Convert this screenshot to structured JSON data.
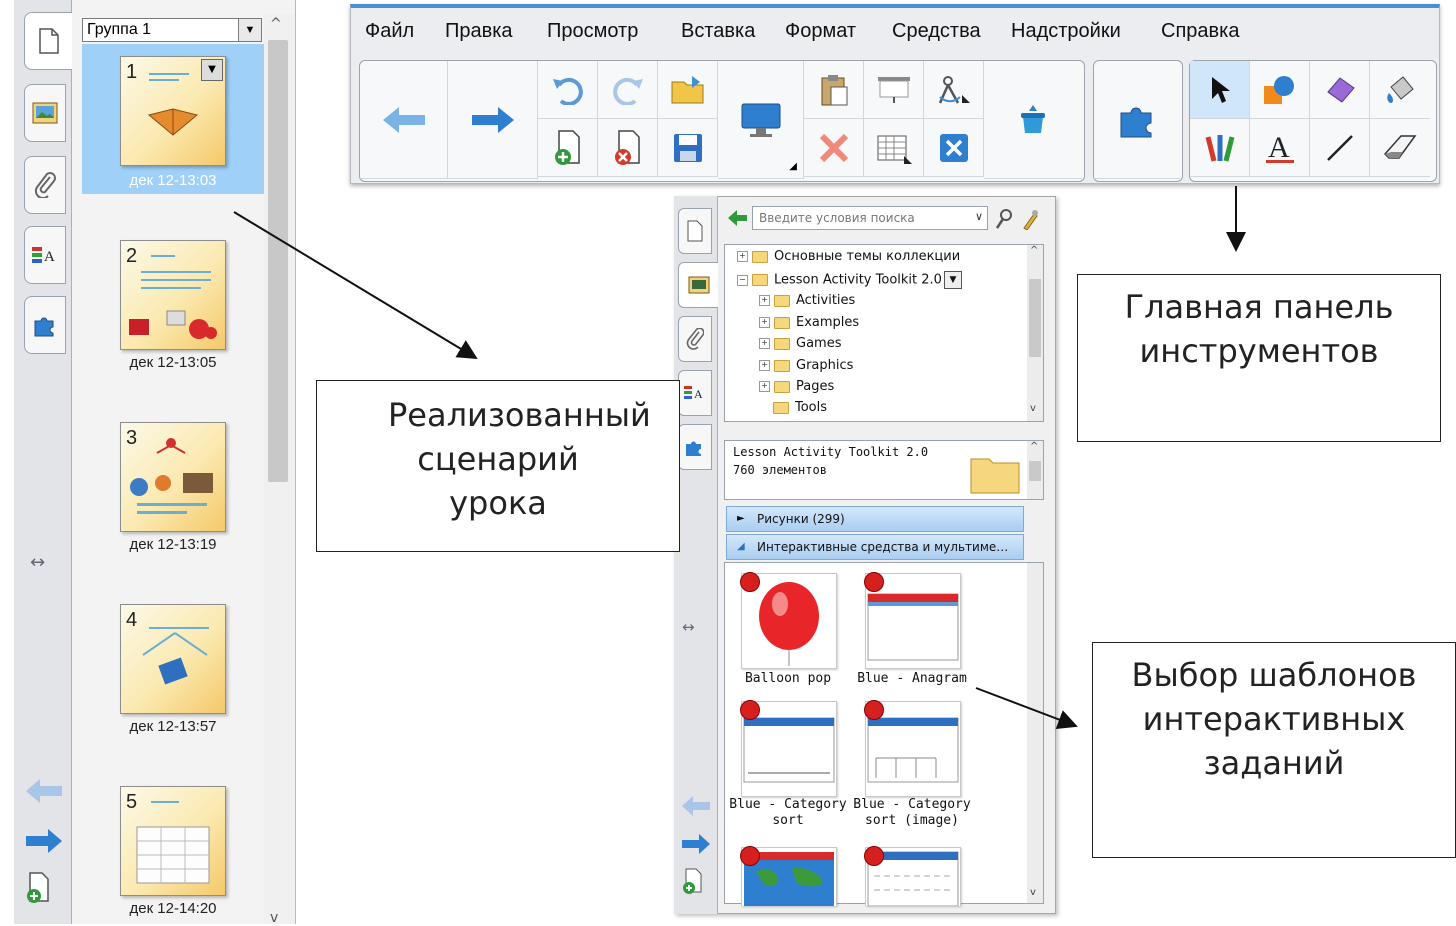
{
  "left_panel": {
    "group_label": "Группа 1",
    "slides": [
      {
        "number": "1",
        "time": "дек 12-13:03",
        "selected": true
      },
      {
        "number": "2",
        "time": "дек 12-13:05",
        "selected": false
      },
      {
        "number": "3",
        "time": "дек 12-13:19",
        "selected": false
      },
      {
        "number": "4",
        "time": "дек 12-13:57",
        "selected": false
      },
      {
        "number": "5",
        "time": "дек 12-14:20",
        "selected": false
      }
    ]
  },
  "toolbar": {
    "menu": [
      "Файл",
      "Правка",
      "Просмотр",
      "Вставка",
      "Формат",
      "Средства",
      "Надстройки",
      "Справка"
    ]
  },
  "gallery": {
    "search_placeholder": "Введите условия поиска",
    "tree": [
      {
        "label": "Основные темы коллекции",
        "level": 0,
        "expander": "+"
      },
      {
        "label": "Lesson Activity Toolkit 2.0",
        "level": 0,
        "expander": "−"
      },
      {
        "label": "Activities",
        "level": 1,
        "expander": "+"
      },
      {
        "label": "Examples",
        "level": 1,
        "expander": "+"
      },
      {
        "label": "Games",
        "level": 1,
        "expander": "+"
      },
      {
        "label": "Graphics",
        "level": 1,
        "expander": "+"
      },
      {
        "label": "Pages",
        "level": 1,
        "expander": "+"
      },
      {
        "label": "Tools",
        "level": 1,
        "expander": ""
      }
    ],
    "info_title": "Lesson Activity Toolkit 2.0",
    "info_count": "760 элементов",
    "categories": [
      {
        "label": "Рисунки (299)",
        "arrow": "►"
      },
      {
        "label": "Интерактивные средства и мультиме…",
        "arrow": "◢"
      }
    ],
    "items": [
      {
        "label": "Balloon pop"
      },
      {
        "label": "Blue - Anagram"
      },
      {
        "label": "Blue - Category sort"
      },
      {
        "label": "Blue - Category sort (image)"
      }
    ]
  },
  "callouts": {
    "lesson": "Реализованный сценарий урока",
    "toolbar": "Главная панель инструментов",
    "templates": "Выбор шаблонов интерактивных заданий"
  },
  "colors": {
    "accent_blue": "#3d8fd8",
    "selection": "#9fd0f7",
    "arrow_blue": "#2f7fd0"
  }
}
